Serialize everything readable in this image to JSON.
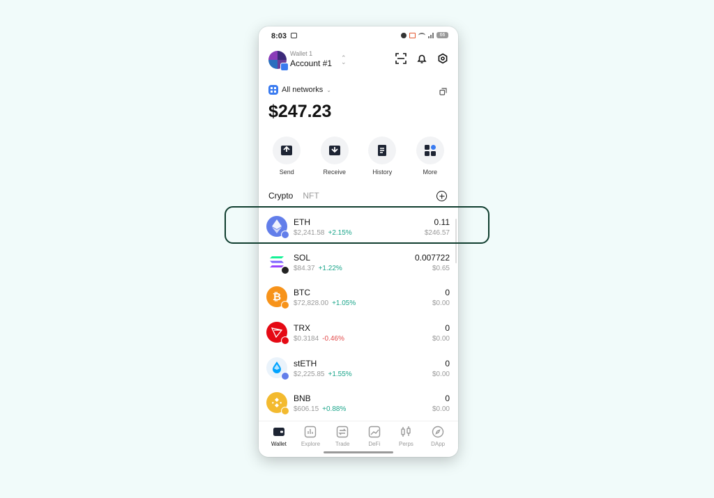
{
  "status_bar": {
    "time": "8:03",
    "battery": "66"
  },
  "header": {
    "wallet_label": "Wallet 1",
    "account_name": "Account #1"
  },
  "networks": {
    "label": "All networks"
  },
  "balance": "$247.23",
  "actions": [
    {
      "label": "Send",
      "icon": "send-icon"
    },
    {
      "label": "Receive",
      "icon": "receive-icon"
    },
    {
      "label": "History",
      "icon": "history-icon"
    },
    {
      "label": "More",
      "icon": "grid-icon"
    }
  ],
  "tabs": [
    {
      "label": "Crypto",
      "active": true
    },
    {
      "label": "NFT",
      "active": false
    }
  ],
  "tokens": [
    {
      "symbol": "ETH",
      "price": "$2,241.58",
      "change": "+2.15%",
      "amount": "0.11",
      "value": "$246.57",
      "color": "#627eea"
    },
    {
      "symbol": "SOL",
      "price": "$84.37",
      "change": "+1.22%",
      "amount": "0.007722",
      "value": "$0.65",
      "color": "#ffffff"
    },
    {
      "symbol": "BTC",
      "price": "$72,828.00",
      "change": "+1.05%",
      "amount": "0",
      "value": "$0.00",
      "color": "#f7931a"
    },
    {
      "symbol": "TRX",
      "price": "$0.3184",
      "change": "-0.46%",
      "amount": "0",
      "value": "$0.00",
      "color": "#e50914"
    },
    {
      "symbol": "stETH",
      "price": "$2,225.85",
      "change": "+1.55%",
      "amount": "0",
      "value": "$0.00",
      "color": "#eaf3fb"
    },
    {
      "symbol": "BNB",
      "price": "$606.15",
      "change": "+0.88%",
      "amount": "0",
      "value": "$0.00",
      "color": "#f3ba2f"
    }
  ],
  "bottom_nav": [
    {
      "label": "Wallet",
      "active": true
    },
    {
      "label": "Explore",
      "active": false
    },
    {
      "label": "Trade",
      "active": false
    },
    {
      "label": "DeFi",
      "active": false
    },
    {
      "label": "Perps",
      "active": false
    },
    {
      "label": "DApp",
      "active": false
    }
  ],
  "colors": {
    "positive": "#1aa58a",
    "negative": "#e24a4a",
    "highlight": "#0f3d2e",
    "accent": "#3a7bf0"
  }
}
